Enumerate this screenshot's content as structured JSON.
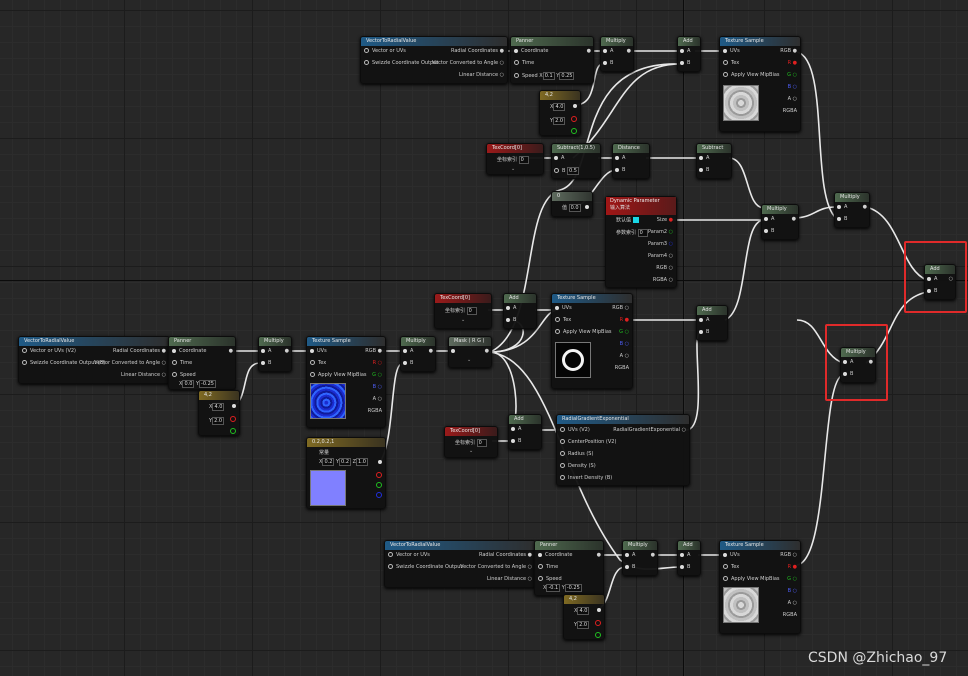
{
  "nodes": {
    "vtr_top": {
      "title": "VectorToRadialValue",
      "in1": "Vector or UVs",
      "in2": "Swizzle Coordinate Output",
      "out1": "Radial Coordinates",
      "out2": "Vector Converted to Angle",
      "out3": "Linear Distance"
    },
    "panner_top": {
      "title": "Panner",
      "coord": "Coordinate",
      "time": "Time",
      "speed": "Speed",
      "x_label": "X",
      "x_val": "0.1",
      "y_label": "Y",
      "y_val": "0.25"
    },
    "multiply_top": {
      "title": "Multiply",
      "a": "A",
      "b": "B"
    },
    "add_top": {
      "title": "Add",
      "a": "A",
      "b": "B"
    },
    "texsample_top": {
      "title": "Texture Sample",
      "uvs": "UVs",
      "tex": "Tex",
      "mip": "Apply View MipBias",
      "rgb": "RGB",
      "r": "R",
      "g": "G",
      "b": "B",
      "a": "A",
      "rgba": "RGBA"
    },
    "const2_top": {
      "title": "4,2",
      "x_label": "X",
      "x_val": "4.0",
      "y_label": "Y",
      "y_val": "2.0"
    },
    "texcoord1": {
      "title": "TexCoord[0]",
      "label": "坐标索引",
      "val": "0"
    },
    "subtract1": {
      "title": "Subtract(1,0.5)",
      "a": "A",
      "b": "B",
      "b_val": "0.5"
    },
    "distance": {
      "title": "Distance",
      "a": "A",
      "b": "B"
    },
    "subtract2": {
      "title": "Subtract",
      "a": "A",
      "b": "B"
    },
    "const0": {
      "title": "0",
      "label": "值",
      "val": "0.0"
    },
    "dynparam": {
      "title": "Dynamic Parameter",
      "subtitle": "输入算法",
      "p1": "默认值",
      "p2": "参数索引",
      "p2_val": "0",
      "size": "Size",
      "param2": "Param2",
      "param3": "Param3",
      "param4": "Param4",
      "rgb": "RGB",
      "rgba": "RGBA"
    },
    "multiply_mid": {
      "title": "Multiply",
      "a": "A",
      "b": "B"
    },
    "multiply_right": {
      "title": "Multiply",
      "a": "A",
      "b": "B"
    },
    "add_final": {
      "title": "Add",
      "a": "A",
      "b": "B"
    },
    "multiply_final": {
      "title": "Multiply",
      "a": "A",
      "b": "B"
    },
    "texcoord2": {
      "title": "TexCoord[0]",
      "label": "坐标索引",
      "val": "0"
    },
    "add_mid": {
      "title": "Add",
      "a": "A",
      "b": "B"
    },
    "texsample_mid": {
      "title": "Texture Sample",
      "uvs": "UVs",
      "tex": "Tex",
      "mip": "Apply View MipBias",
      "rgb": "RGB",
      "r": "R",
      "g": "G",
      "b": "B",
      "a": "A",
      "rgba": "RGBA"
    },
    "add_mid2": {
      "title": "Add",
      "a": "A",
      "b": "B"
    },
    "vtr_left": {
      "title": "VectorToRadialValue",
      "in1": "Vector or UVs (V2)",
      "in2": "Swizzle Coordinate Output (B)",
      "out1": "Radial Coordinates",
      "out2": "Vector Converted to Angle",
      "out3": "Linear Distance"
    },
    "panner_left": {
      "title": "Panner",
      "coord": "Coordinate",
      "time": "Time",
      "speed": "Speed",
      "x_label": "X",
      "x_val": "0.0",
      "y_label": "Y",
      "y_val": "-0.25"
    },
    "multiply_left": {
      "title": "Multiply",
      "a": "A",
      "b": "B"
    },
    "const2_left": {
      "title": "4,2",
      "x_label": "X",
      "x_val": "4.0",
      "y_label": "Y",
      "y_val": "2.0"
    },
    "texsample_left": {
      "title": "Texture Sample",
      "uvs": "UVs",
      "tex": "Tex",
      "mip": "Apply View MipBias",
      "rgb": "RGB",
      "r": "R",
      "g": "G",
      "b": "B",
      "a": "A",
      "rgba": "RGBA"
    },
    "multiply_left2": {
      "title": "Multiply",
      "a": "A",
      "b": "B"
    },
    "mask": {
      "title": "Mask ( R G )"
    },
    "const3": {
      "title": "0.2,0.2,1",
      "label": "常量",
      "x_label": "X",
      "x_val": "0.2",
      "y_label": "Y",
      "y_val": "0.2",
      "z_label": "Z",
      "z_val": "1.0"
    },
    "texcoord3": {
      "title": "TexCoord[0]",
      "label": "坐标索引",
      "val": "0"
    },
    "add_low": {
      "title": "Add",
      "a": "A",
      "b": "B"
    },
    "radial": {
      "title": "RadialGradientExponential",
      "uvs": "UVs (V2)",
      "center": "CenterPosition (V2)",
      "radius": "Radius (S)",
      "density": "Density (S)",
      "invert": "Invert Density (B)",
      "out": "RadialGradientExponential"
    },
    "vtr_bottom": {
      "title": "VectorToRadialValue",
      "in1": "Vector or UVs",
      "in2": "Swizzle Coordinate Output",
      "out1": "Radial Coordinates",
      "out2": "Vector Converted to Angle",
      "out3": "Linear Distance"
    },
    "panner_bottom": {
      "title": "Panner",
      "coord": "Coordinate",
      "time": "Time",
      "speed": "Speed",
      "x_label": "X",
      "x_val": "-0.1",
      "y_label": "Y",
      "y_val": "-0.25"
    },
    "multiply_bottom": {
      "title": "Multiply",
      "a": "A",
      "b": "B"
    },
    "add_bottom": {
      "title": "Add",
      "a": "A",
      "b": "B"
    },
    "texsample_bottom": {
      "title": "Texture Sample",
      "uvs": "UVs",
      "tex": "Tex",
      "mip": "Apply View MipBias",
      "rgb": "RGB",
      "r": "R",
      "g": "G",
      "b": "B",
      "a": "A",
      "rgba": "RGBA"
    },
    "const2_bottom": {
      "title": "4,2",
      "x_label": "X",
      "x_val": "4.0",
      "y_label": "Y",
      "y_val": "2.0"
    }
  },
  "watermark": "CSDN @Zhichao_97",
  "colors": {
    "highlight": "#e02a2a",
    "wire": "#e8e8e8",
    "pin_r": "#e02020",
    "pin_g": "#20c020",
    "pin_b": "#2030e0",
    "dyn_swatch": "#19d7e6"
  }
}
